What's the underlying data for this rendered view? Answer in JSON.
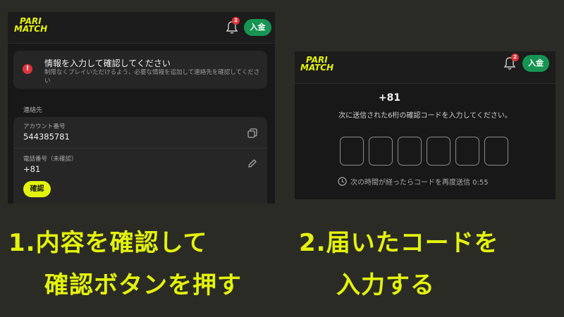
{
  "left": {
    "logo_top": "PARI",
    "logo_bottom": "MATCH",
    "notification_count": "2",
    "deposit_label": "入金",
    "alert": {
      "icon": "!",
      "title": "情報を入力して確認してください",
      "text": "制限なくプレイいただけるよう、必要な情報を追加して連絡先を確認してください"
    },
    "section_label": "連絡先",
    "account": {
      "label": "アカウント番号",
      "value": "544385781"
    },
    "phone": {
      "label": "電話番号（未確認）",
      "value": "+81"
    },
    "confirm_label": "確認"
  },
  "right": {
    "logo_top": "PARI",
    "logo_bottom": "MATCH",
    "notification_count": "2",
    "deposit_label": "入金",
    "phone_prefix": "+81",
    "instruction": "次に送信された6桁の確認コードを入力してください。",
    "code_digits": [
      "",
      "",
      "",
      "",
      "",
      ""
    ],
    "resend_text": "次の時間が経ったらコードを再度送信 0:55"
  },
  "captions": {
    "step1_line1": "1.内容を確認して",
    "step1_line2": "確認ボタンを押す",
    "step2_line1": "2.届いたコードを",
    "step2_line2": "入力する"
  },
  "colors": {
    "brand_yellow": "#e3f30d",
    "deposit_green": "#169552",
    "alert_red": "#e0343b",
    "background": "#2b2b26"
  }
}
